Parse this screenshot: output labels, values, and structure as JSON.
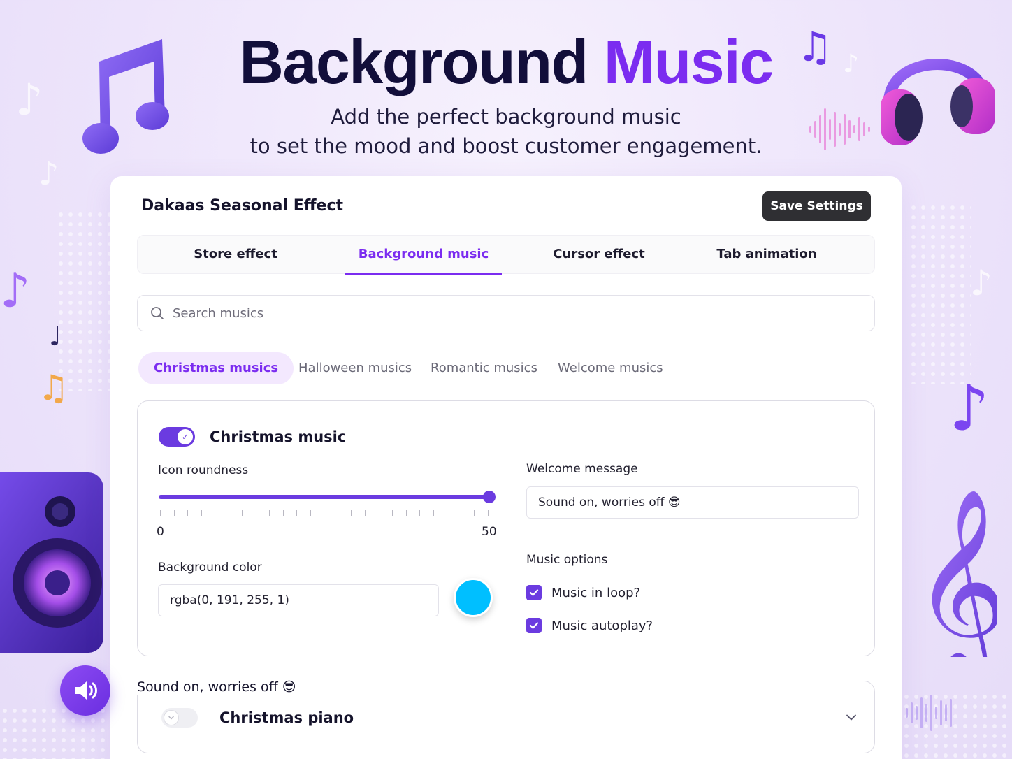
{
  "hero": {
    "title_main": "Background",
    "title_accent": "Music",
    "subtitle_line1": "Add the perfect background music",
    "subtitle_line2": "to set the mood and boost customer engagement."
  },
  "app": {
    "title": "Dakaas Seasonal Effect",
    "save_label": "Save Settings"
  },
  "tabs": [
    {
      "label": "Store effect",
      "active": false
    },
    {
      "label": "Background music",
      "active": true
    },
    {
      "label": "Cursor effect",
      "active": false
    },
    {
      "label": "Tab animation",
      "active": false
    }
  ],
  "search": {
    "placeholder": "Search musics",
    "icon": "search-icon"
  },
  "categories": [
    {
      "label": "Christmas musics",
      "active": true
    },
    {
      "label": "Halloween musics",
      "active": false
    },
    {
      "label": "Romantic musics",
      "active": false
    },
    {
      "label": "Welcome musics",
      "active": false
    }
  ],
  "panel": {
    "toggle_on": true,
    "title": "Christmas music",
    "icon_roundness": {
      "label": "Icon roundness",
      "min": "0",
      "max": "50",
      "value": 50
    },
    "background_color": {
      "label": "Background color",
      "value": "rgba(0, 191, 255, 1)",
      "swatch_hex": "#00bfff"
    },
    "welcome_message": {
      "label": "Welcome message",
      "value": "Sound on, worries off 😎"
    },
    "music_options": {
      "label": "Music options",
      "options": [
        {
          "label": "Music in loop?",
          "checked": true
        },
        {
          "label": "Music autoplay?",
          "checked": true
        }
      ]
    }
  },
  "panel2": {
    "legend": "Sound on, worries off 😎",
    "title": "Christmas piano",
    "toggle_on": false
  },
  "colors": {
    "accent": "#7b2cf0",
    "toggle": "#6b3be0",
    "button_dark": "#2f2f33",
    "swatch": "#00bfff"
  },
  "icons": [
    "music-note-icon",
    "headphones-icon",
    "speaker-icon",
    "treble-clef-icon",
    "volume-icon",
    "search-icon",
    "check-icon",
    "chevron-down-icon"
  ]
}
